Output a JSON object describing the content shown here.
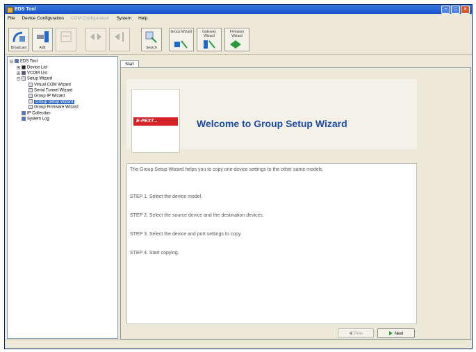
{
  "window": {
    "title": "EDS Tool"
  },
  "menu": [
    {
      "label": "File",
      "enabled": true
    },
    {
      "label": "Device Configuration",
      "enabled": true
    },
    {
      "label": "COM Configuration",
      "enabled": false
    },
    {
      "label": "System",
      "enabled": true
    },
    {
      "label": "Help",
      "enabled": true
    }
  ],
  "toolbar": [
    {
      "label": "Broadcast",
      "icon": "broadcast-icon"
    },
    {
      "label": "Add",
      "icon": "add-device-icon"
    },
    {
      "label": "",
      "icon": "config-icon"
    },
    {
      "label": "",
      "icon": "network-icon"
    },
    {
      "label": "",
      "icon": "antenna-icon"
    },
    {
      "label": "Search",
      "icon": "search-icon"
    },
    {
      "label": "Group Wizard",
      "icon": "group-wizard-icon"
    },
    {
      "label": "Gateway Wizard",
      "icon": "gateway-wizard-icon"
    },
    {
      "label": "Firmware Wizard",
      "icon": "firmware-wizard-icon"
    }
  ],
  "tree": {
    "root": "EDS Tool",
    "items": [
      {
        "label": "Device List",
        "level": 1
      },
      {
        "label": "VCOM List",
        "level": 1
      },
      {
        "label": "Setup Wizard",
        "level": 1
      },
      {
        "label": "Virtual COM Wizard",
        "level": 2
      },
      {
        "label": "Serial Tunnel Wizard",
        "level": 2
      },
      {
        "label": "Group IP Wizard",
        "level": 2
      },
      {
        "label": "Group Setup Wizard",
        "level": 2,
        "selected": true
      },
      {
        "label": "Group Firmware Wizard",
        "level": 2
      },
      {
        "label": "IP Collection",
        "level": 1
      },
      {
        "label": "System Log",
        "level": 1
      }
    ]
  },
  "tab": {
    "label": "Start"
  },
  "header": {
    "logo_text": "E-PEXT...",
    "title": "Welcome to Group Setup Wizard"
  },
  "body": {
    "intro": "The Group Setup Wizard helps you to copy one device settings to the other same models.",
    "steps": [
      "STEP 1. Select the device model.",
      "STEP 2. Select the source device and the destination devices.",
      "STEP 3. Select the device and port settings to copy.",
      "STEP 4. Start copying."
    ]
  },
  "buttons": {
    "prev": {
      "label": "Prev",
      "enabled": false
    },
    "next": {
      "label": "Next",
      "enabled": true
    }
  },
  "colors": {
    "title_blue": "#1a49a8",
    "logo_red": "#d42027",
    "accent_green": "#2a9a3c"
  }
}
